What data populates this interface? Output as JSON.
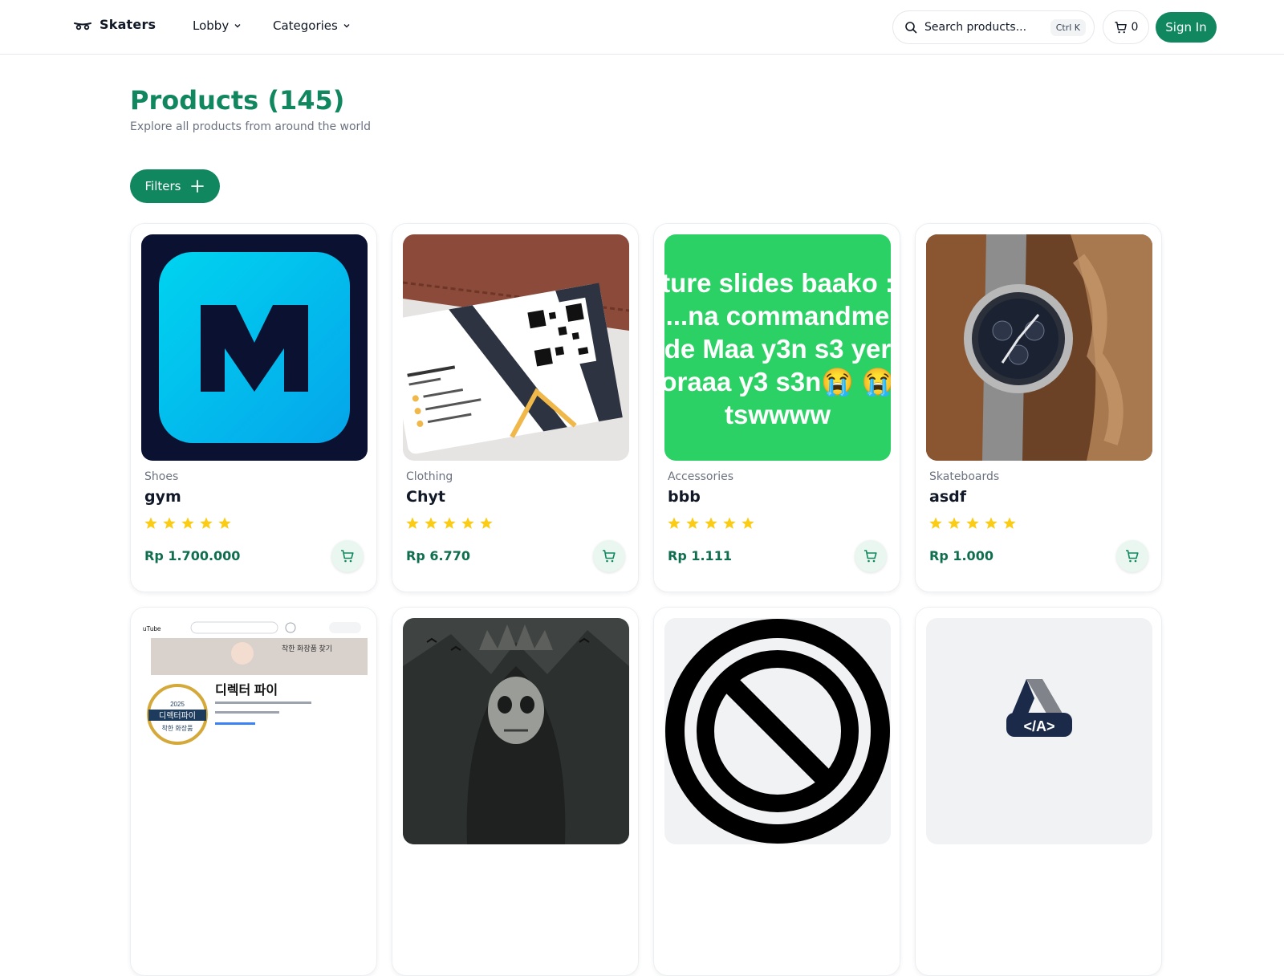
{
  "header": {
    "brand": "Skaters",
    "nav": [
      {
        "label": "Lobby"
      },
      {
        "label": "Categories"
      }
    ],
    "search": {
      "placeholder": "Search products...",
      "shortcut": "Ctrl K"
    },
    "cart_count": "0",
    "signin_label": "Sign In"
  },
  "page": {
    "title": "Products (145)",
    "subtitle": "Explore all products from around the world",
    "filters_label": "Filters"
  },
  "products": [
    {
      "category": "Shoes",
      "name": "gym",
      "price": "Rp 1.700.000",
      "rating": 5,
      "image": "logo-m-icon"
    },
    {
      "category": "Clothing",
      "name": "Chyt",
      "price": "Rp 6.770",
      "rating": 5,
      "image": "business-card-photo"
    },
    {
      "category": "Accessories",
      "name": "bbb",
      "price": "Rp 1.111",
      "rating": 5,
      "image": "green-text-card",
      "image_text": [
        "ture slides baako :",
        "...na commandme",
        "de Maa y3n s3 yer",
        "oraaa y3 s3n😭 😭",
        "tswwww"
      ]
    },
    {
      "category": "Skateboards",
      "name": "asdf",
      "price": "Rp 1.000",
      "rating": 5,
      "image": "wristwatch-photo"
    },
    {
      "category": "",
      "name": "",
      "price": "",
      "rating": 0,
      "image": "korean-youtube-screenshot",
      "image_text": [
        "uTube",
        "착한 화장품 찾기",
        "디렉터 파이",
        "2025",
        "디렉터파이",
        "착한 화장품"
      ]
    },
    {
      "category": "",
      "name": "",
      "price": "",
      "rating": 0,
      "image": "skull-king-artwork"
    },
    {
      "category": "",
      "name": "",
      "price": "",
      "rating": 0,
      "image": "prohibited-sign-icon"
    },
    {
      "category": "",
      "name": "",
      "price": "",
      "rating": 0,
      "image": "code-logo-icon",
      "image_text": [
        "</A>"
      ]
    }
  ],
  "colors": {
    "brand": "#10875f",
    "price": "#0f6e4e",
    "star": "#facc15"
  }
}
